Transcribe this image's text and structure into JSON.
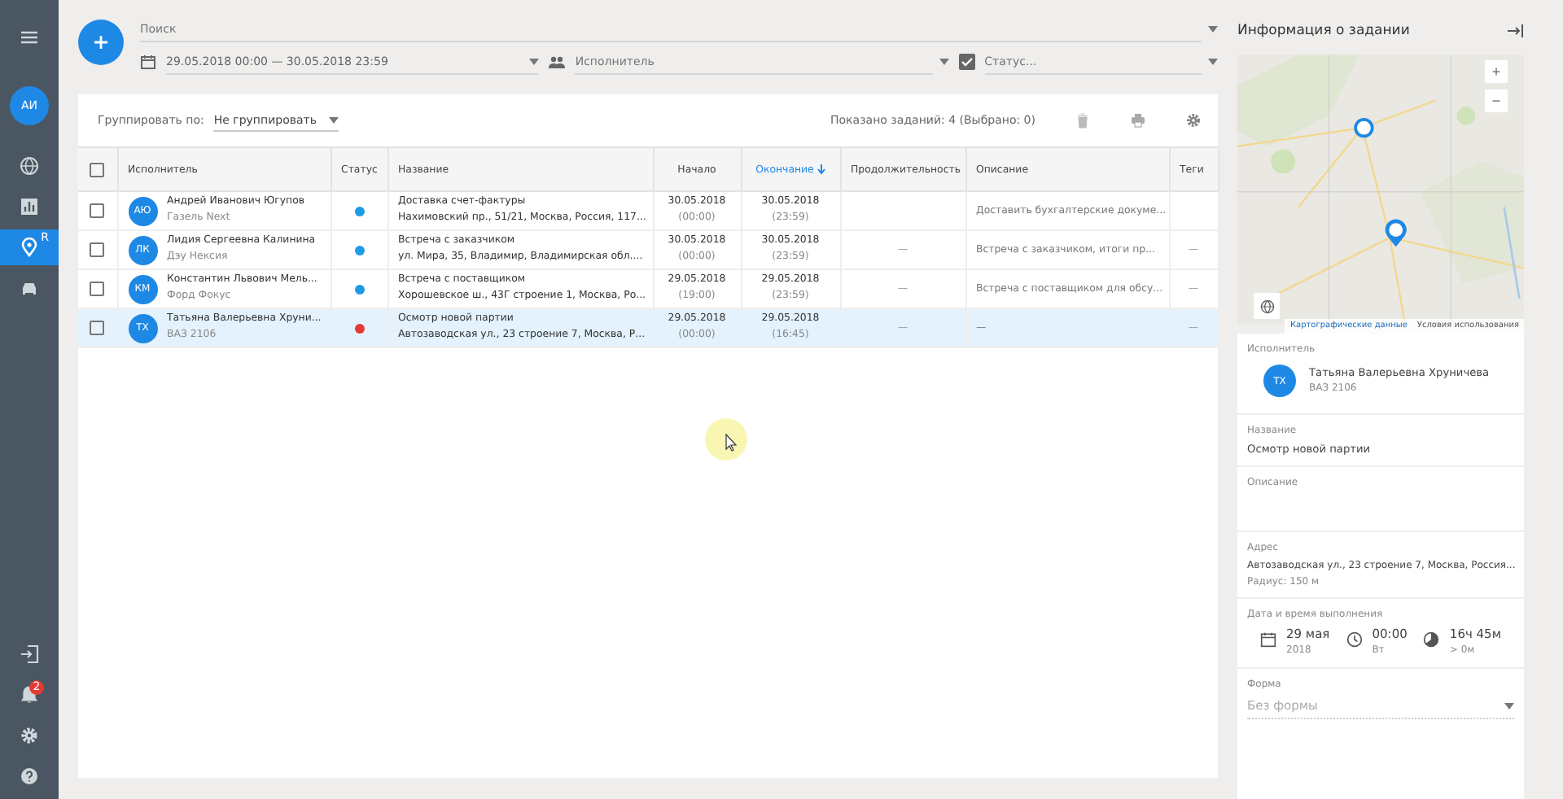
{
  "sidebar": {
    "avatar": "АИ",
    "items": [
      {
        "selected": false
      },
      {
        "selected": false
      },
      {
        "selected": true,
        "badge": "R"
      },
      {
        "selected": false
      }
    ],
    "notifications": "2"
  },
  "filters": {
    "search": {
      "placeholder": "Поиск"
    },
    "date_range": "29.05.2018 00:00 — 30.05.2018 23:59",
    "executor": {
      "placeholder": "Исполнитель"
    },
    "status": {
      "placeholder": "Статус...",
      "checked": true
    }
  },
  "toolbar": {
    "group_label": "Группировать по:",
    "group_value": "Не группировать",
    "shown": "Показано заданий: 4 (Выбрано: 0)"
  },
  "table": {
    "all_checked": false,
    "columns": [
      {
        "label": "Исполнитель",
        "sorted": false
      },
      {
        "label": "Статус",
        "sorted": false
      },
      {
        "label": "Название",
        "sorted": false
      },
      {
        "label": "Начало",
        "sorted": false
      },
      {
        "label": "Окончание",
        "sorted": true
      },
      {
        "label": "Продолжительность",
        "sorted": false
      },
      {
        "label": "Описание",
        "sorted": false
      },
      {
        "label": "Теги",
        "sorted": false
      }
    ],
    "rows": [
      {
        "selected": false,
        "checked": false,
        "initials": "АЮ",
        "name": "Андрей Иванович Югупов",
        "car": "Газель Next",
        "color": "#1e9be6",
        "title": "Доставка счет-фактуры",
        "address": "Нахимовский пр., 51/21, Москва, Россия, 117...",
        "start_date": "30.05.2018",
        "start_time": "(00:00)",
        "end_date": "30.05.2018",
        "end_time": "(23:59)",
        "description": "Доставить бухгалтерские докуме..."
      },
      {
        "selected": false,
        "checked": false,
        "initials": "ЛК",
        "name": "Лидия Сергеевна Калинина",
        "car": "Дэу Нексия",
        "color": "#1e9be6",
        "title": "Встреча с заказчиком",
        "address": "ул. Мира, 35, Владимир, Владимирская обл....",
        "start_date": "30.05.2018",
        "start_time": "(00:00)",
        "end_date": "30.05.2018",
        "end_time": "(23:59)",
        "duration": "—",
        "description": "Встреча с заказчиком, итоги пр...",
        "tags": "—"
      },
      {
        "selected": false,
        "checked": false,
        "initials": "КМ",
        "name": "Константин Львович Мель...",
        "car": "Форд Фокус",
        "color": "#1e9be6",
        "title": "Встреча с поставщиком",
        "address": "Хорошевское ш., 43Г строение 1, Москва, Ро...",
        "start_date": "29.05.2018",
        "start_time": "(19:00)",
        "end_date": "29.05.2018",
        "end_time": "(23:59)",
        "duration": "—",
        "description": "Встреча с поставщиком для обсу...",
        "tags": "—"
      },
      {
        "selected": true,
        "checked": false,
        "initials": "ТХ",
        "name": "Татьяна Валерьевна Хруни...",
        "car": "ВАЗ 2106",
        "color": "#e53935",
        "title": "Осмотр новой партии",
        "address": "Автозаводская ул., 23 строение 7, Москва, Р...",
        "start_date": "29.05.2018",
        "start_time": "(00:00)",
        "end_date": "29.05.2018",
        "end_time": "(16:45)",
        "duration": "—",
        "description": "—",
        "tags": "—"
      }
    ]
  },
  "panel": {
    "title": "Информация о задании",
    "map": {
      "zoom_in": "+",
      "zoom_out": "−",
      "attribution": "Картографические данные",
      "terms": "Условия использования"
    },
    "executor": {
      "label": "Исполнитель",
      "initials": "ТХ",
      "name": "Татьяна Валерьевна Хруничева",
      "car": "ВАЗ 2106"
    },
    "name": {
      "label": "Название",
      "value": "Осмотр новой партии"
    },
    "description": {
      "label": "Описание"
    },
    "address": {
      "label": "Адрес",
      "value": "Автозаводская ул., 23 строение 7, Москва, Россия...",
      "radius": "Радиус: 150 м"
    },
    "datetime": {
      "label": "Дата и время выполнения",
      "date": "29 мая",
      "year": "2018",
      "time": "00:00",
      "weekday": "Вт",
      "duration": "16ч 45м",
      "duration_note": "> 0м"
    },
    "form": {
      "label": "Форма",
      "placeholder": "Без формы"
    }
  }
}
